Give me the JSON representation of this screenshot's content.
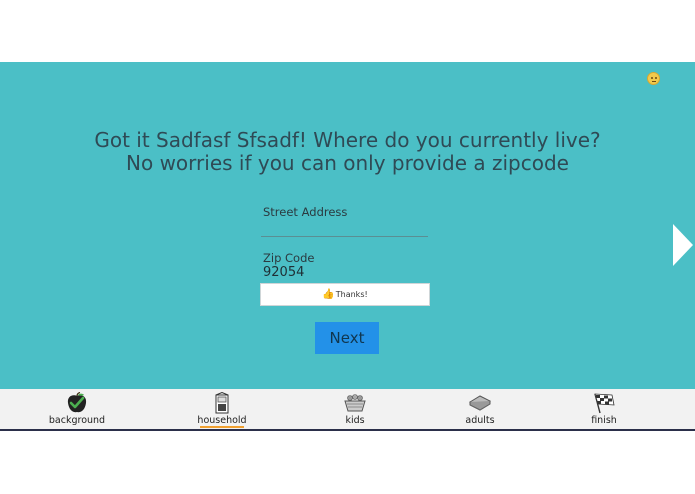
{
  "status_emoji": {
    "icon": "neutral-face-icon"
  },
  "heading": {
    "line1": "Got it Sadfasf Sfsadf! Where do you currently live?",
    "line2": "No worries if you can only provide a zipcode"
  },
  "form": {
    "street_label": "Street Address",
    "street_value": "",
    "zip_label": "Zip Code",
    "zip_value": "92054",
    "thanks_text": "Thanks!",
    "thanks_icon": "thumbs-up-icon",
    "next_label": "Next"
  },
  "nav": {
    "next_arrow_icon": "chevron-right-icon",
    "items": [
      {
        "label": "background",
        "icon": "apple-check-icon",
        "active": false
      },
      {
        "label": "household",
        "icon": "house-door-icon",
        "active": true
      },
      {
        "label": "kids",
        "icon": "kids-basket-icon",
        "active": false
      },
      {
        "label": "adults",
        "icon": "sandwich-icon",
        "active": false
      },
      {
        "label": "finish",
        "icon": "checkered-flag-icon",
        "active": false
      }
    ]
  },
  "colors": {
    "panel": "#4bbfc6",
    "heading_text": "#2f4a55",
    "next_button": "#2391e8",
    "active_underline": "#f0a030",
    "bottom_bar": "#f2f2f2"
  }
}
